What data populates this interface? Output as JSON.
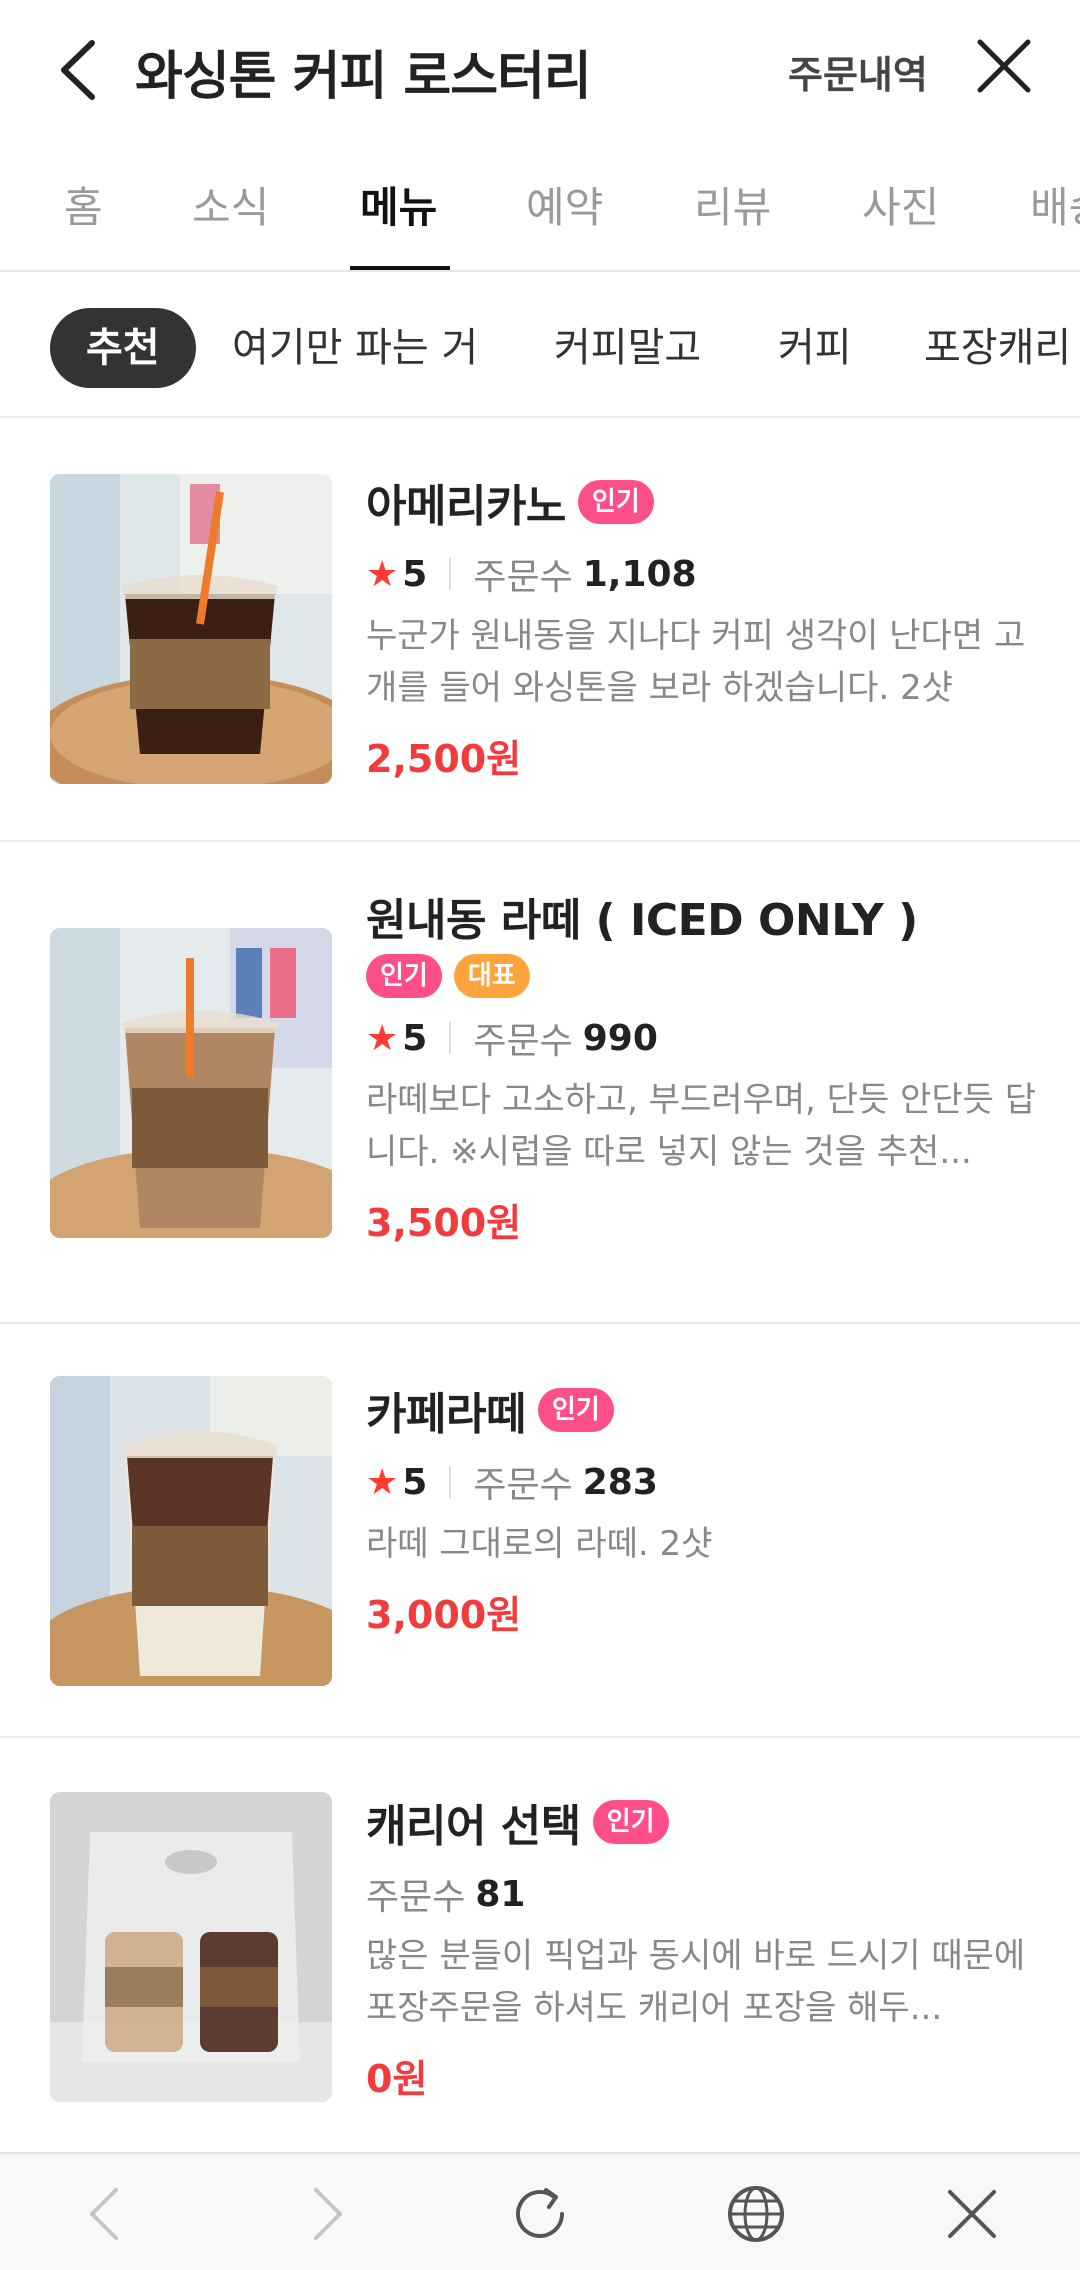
{
  "header": {
    "title": "와싱톤 커피 로스터리",
    "orders_label": "주문내역"
  },
  "tabs": [
    {
      "label": "홈"
    },
    {
      "label": "소식"
    },
    {
      "label": "메뉴"
    },
    {
      "label": "예약"
    },
    {
      "label": "리뷰"
    },
    {
      "label": "사진"
    },
    {
      "label": "배송"
    }
  ],
  "chips": [
    {
      "label": "추천"
    },
    {
      "label": "여기만 파는 거"
    },
    {
      "label": "커피말고"
    },
    {
      "label": "커피"
    },
    {
      "label": "포장캐리"
    }
  ],
  "menu": {
    "items": [
      {
        "name": "아메리카노",
        "badges": [
          "인기"
        ],
        "rating": "5",
        "orders_label": "주문수",
        "orders": "1,108",
        "desc": "누군가 원내동을 지나다 커피 생각이 난다면 고개를 들어 와싱톤을 보라 하겠습니다. 2샷",
        "price": "2,500원"
      },
      {
        "name": "원내동 라떼 ( ICED ONLY )",
        "badges": [
          "인기",
          "대표"
        ],
        "rating": "5",
        "orders_label": "주문수",
        "orders": "990",
        "desc": "라떼보다 고소하고, 부드러우며, 단듯 안단듯 답니다. ※시럽을 따로 넣지 않는 것을 추천...",
        "price": "3,500원"
      },
      {
        "name": "카페라떼",
        "badges": [
          "인기"
        ],
        "rating": "5",
        "orders_label": "주문수",
        "orders": "283",
        "desc": "라떼 그대로의 라떼. 2샷",
        "price": "3,000원"
      },
      {
        "name": "캐리어 선택",
        "badges": [
          "인기"
        ],
        "orders_label": "주문수",
        "orders": "81",
        "desc": "많은 분들이 픽업과 동시에 바로 드시기 때문에 포장주문을 하셔도 캐리어 포장을 해두...",
        "price": "0원"
      }
    ]
  },
  "colors": {
    "accent_red": "#f03c3c",
    "badge_pink": "#ff4f8b",
    "badge_orange": "#ffa43c",
    "star": "#ff3b30"
  },
  "icons": {
    "back": "chevron-left-icon",
    "close": "close-icon",
    "star": "star-icon",
    "browser_back": "chevron-left-icon",
    "browser_forward": "chevron-right-icon",
    "refresh": "refresh-icon",
    "globe": "globe-icon",
    "browser_close": "close-icon"
  }
}
